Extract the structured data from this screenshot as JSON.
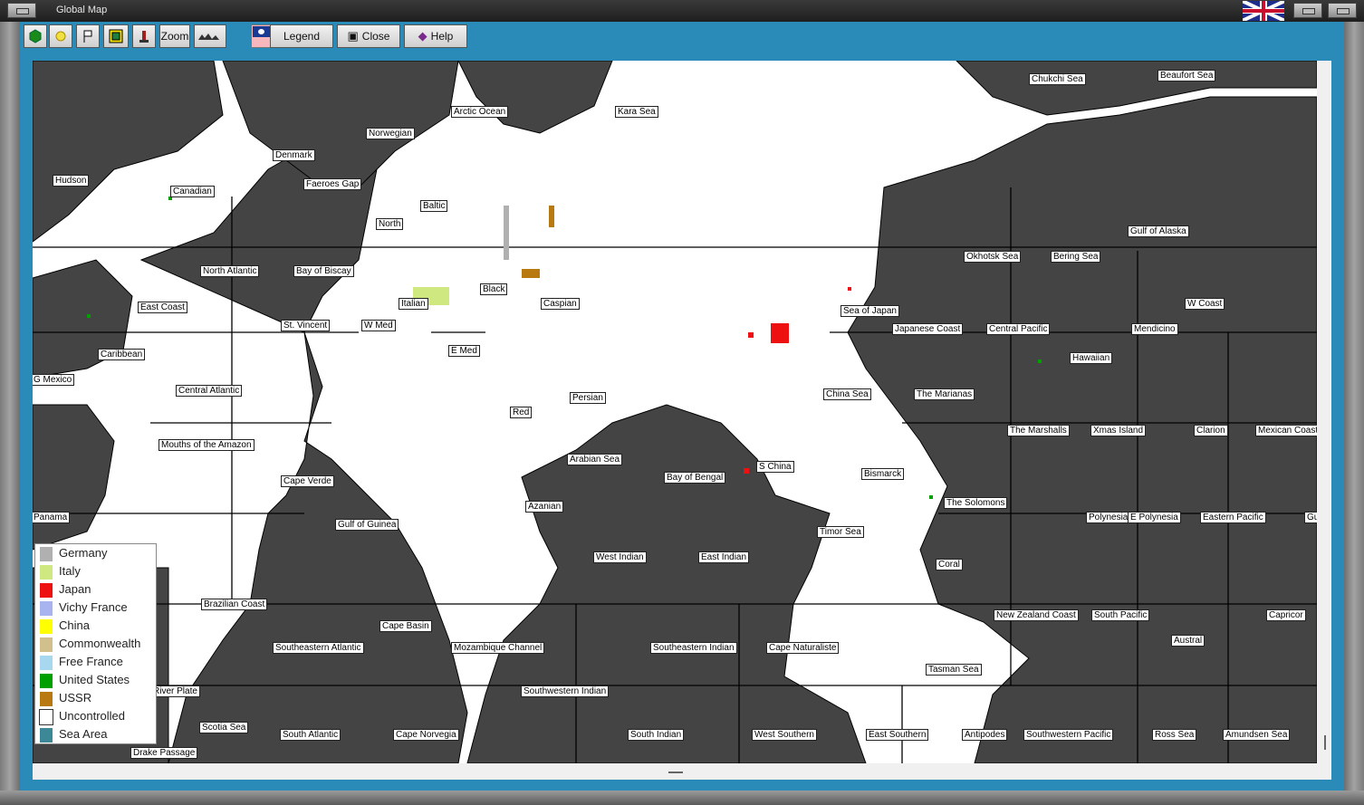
{
  "window": {
    "title": "Global Map"
  },
  "toolbar": {
    "zoom": "Zoom",
    "legend": "Legend",
    "close": "Close",
    "help": "Help"
  },
  "colors": {
    "sea": "#444444",
    "land": "#ffffff",
    "panel": "#2b8bb8"
  },
  "legend": [
    {
      "name": "Germany",
      "color": "#b0b0b0"
    },
    {
      "name": "Italy",
      "color": "#cfe880"
    },
    {
      "name": "Japan",
      "color": "#ee1111"
    },
    {
      "name": "Vichy France",
      "color": "#a8b4f0"
    },
    {
      "name": "China",
      "color": "#ffff00"
    },
    {
      "name": "Commonwealth",
      "color": "#d2c08c"
    },
    {
      "name": "Free France",
      "color": "#a8d8f0"
    },
    {
      "name": "United States",
      "color": "#00a000"
    },
    {
      "name": "USSR",
      "color": "#b87a10"
    },
    {
      "name": "Uncontrolled",
      "color": "#ffffff"
    },
    {
      "name": "Sea Area",
      "color": "#3c8896"
    }
  ],
  "sea_areas": [
    "Chukchi Sea",
    "Beaufort Sea",
    "Arctic Ocean",
    "Kara Sea",
    "Norwegian",
    "Denmark",
    "Hudson",
    "Canadian",
    "Faeroes Gap",
    "Baltic",
    "North",
    "Gulf of Alaska",
    "Okhotsk Sea",
    "Bering Sea",
    "North Atlantic",
    "Bay of Biscay",
    "Black",
    "Caspian",
    "Italian",
    "East Coast",
    "Sea of Japan",
    "W Coast",
    "St. Vincent",
    "W Med",
    "Japanese Coast",
    "Central Pacific",
    "Mendicino",
    "Caribbean",
    "E Med",
    "Hawaiian",
    "G Mexico",
    "Central Atlantic",
    "Persian",
    "China Sea",
    "The Marianas",
    "Red",
    "The Marshalls",
    "Xmas Island",
    "Clarion",
    "Mexican Coast",
    "Mouths of the Amazon",
    "Arabian Sea",
    "S China",
    "Bismarck",
    "Cape Verde",
    "Bay of Bengal",
    "Azanian",
    "The Solomons",
    "Panama",
    "Polynesia",
    "E Polynesia",
    "Eastern Pacific",
    "Gu",
    "Gulf of Guinea",
    "Timor Sea",
    "West Indian",
    "East Indian",
    "Coral",
    "Brazilian Coast",
    "New Zealand Coast",
    "South Pacific",
    "Capricor",
    "Cape Basin",
    "Austral",
    "Southeastern Atlantic",
    "Mozambique Channel",
    "Southeastern Indian",
    "Cape Naturaliste",
    "Tasman Sea",
    "River Plate",
    "Southwestern Indian",
    "Scotia Sea",
    "South Atlantic",
    "Cape Norvegia",
    "South Indian",
    "West Southern",
    "East Southern",
    "Antipodes",
    "Southwestern Pacific",
    "Ross Sea",
    "Amundsen Sea",
    "Drake Passage"
  ]
}
